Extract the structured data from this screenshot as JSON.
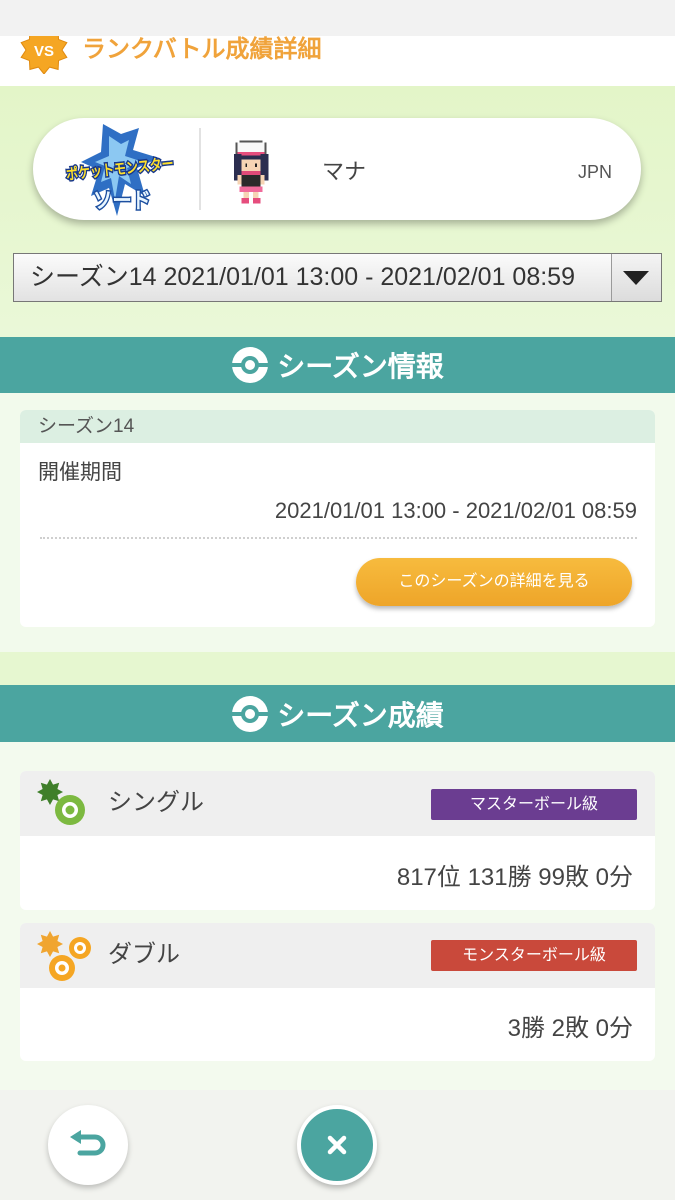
{
  "header": {
    "badge_text": "VS",
    "badge_icon": "vs-badge-icon",
    "title": "ランクバトル成績詳細"
  },
  "profile": {
    "game_logo": {
      "line1": "ポケットモンスター",
      "line2": "ソード"
    },
    "avatar_icon": "trainer-sprite",
    "name": "マナ",
    "region": "JPN"
  },
  "season_select": {
    "selected": "シーズン14 2021/01/01 13:00 - 2021/02/01 08:59",
    "icon": "dropdown-arrow-icon"
  },
  "season_info": {
    "heading": "シーズン情報",
    "heading_icon": "ball-icon",
    "season_label": "シーズン14",
    "period_label": "開催期間",
    "period_value": "2021/01/01 13:00 - 2021/02/01 08:59",
    "detail_button": "このシーズンの詳細を見る"
  },
  "season_results": {
    "heading": "シーズン成績",
    "heading_icon": "ball-icon",
    "items": [
      {
        "icon": "single-battle-icon",
        "format": "シングル",
        "rank_class": "マスターボール級",
        "rank_color": "#6b3d91",
        "record": "817位 131勝 99敗 0分"
      },
      {
        "icon": "double-battle-icon",
        "format": "ダブル",
        "rank_class": "モンスターボール級",
        "rank_color": "#c9493b",
        "record": "3勝 2敗 0分"
      }
    ]
  },
  "footer": {
    "back_icon": "return-arrow-icon",
    "close_icon": "close-icon"
  },
  "colors": {
    "accent_teal": "#4ba5a0",
    "button_orange": "#f3b23a",
    "title_orange": "#f0a33b",
    "background_green": "#e6f7d0"
  }
}
